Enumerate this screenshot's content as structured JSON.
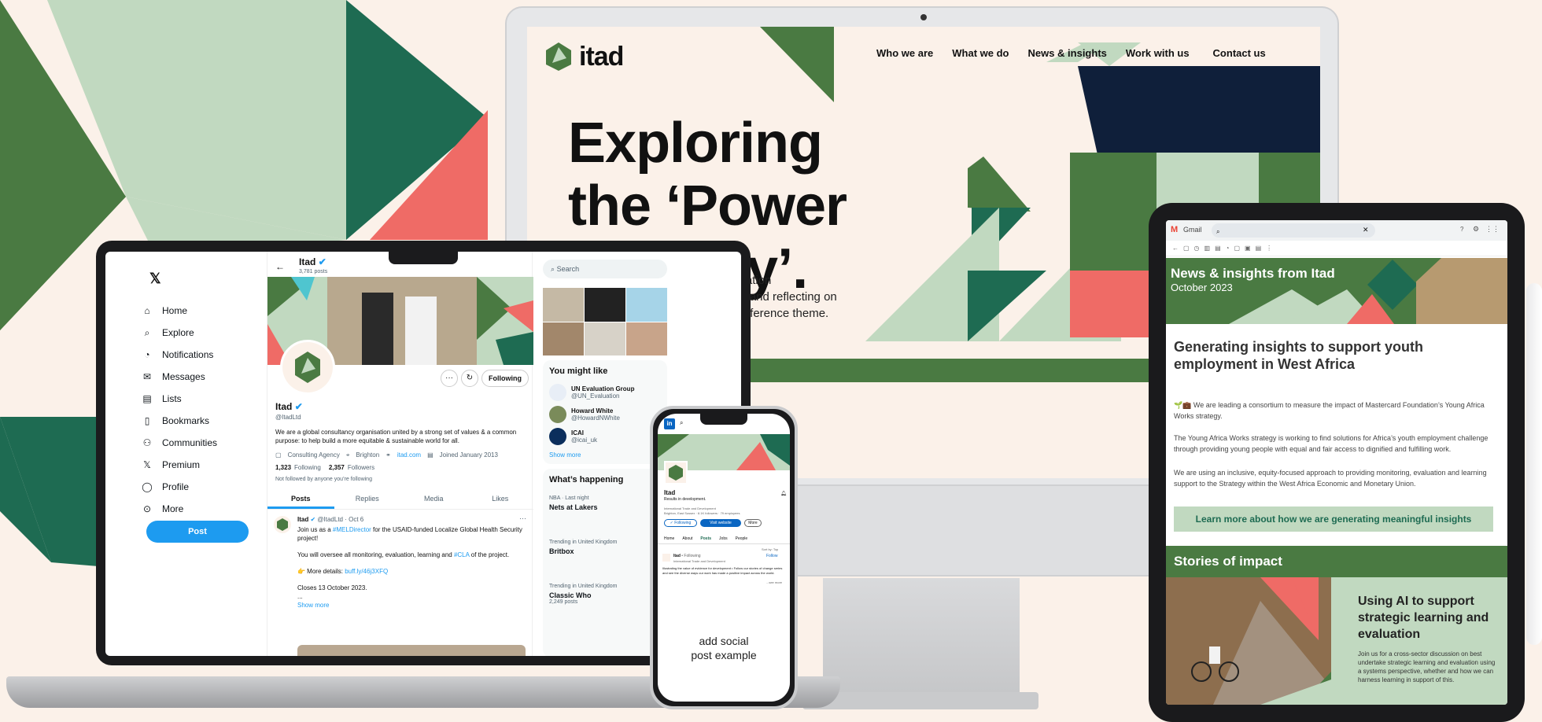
{
  "monitor_site": {
    "logo_text": "itad",
    "nav": [
      "Who we are",
      "What we do",
      "News & insights",
      "Work with us",
      "Contact us"
    ],
    "hero_line1": "Exploring",
    "hero_line2": "the ‘Power",
    "hero_line3": "ry’.",
    "body_line1": "n Association",
    "body_line2": "ns, skills and reflecting on",
    "body_line3": "ear’s conference theme."
  },
  "twitter": {
    "nav": [
      {
        "label": "Home",
        "icon": "home-icon"
      },
      {
        "label": "Explore",
        "icon": "search-icon"
      },
      {
        "label": "Notifications",
        "icon": "bell-icon"
      },
      {
        "label": "Messages",
        "icon": "mail-icon"
      },
      {
        "label": "Lists",
        "icon": "list-icon"
      },
      {
        "label": "Bookmarks",
        "icon": "bookmark-icon"
      },
      {
        "label": "Communities",
        "icon": "communities-icon"
      },
      {
        "label": "Premium",
        "icon": "x-icon"
      },
      {
        "label": "Profile",
        "icon": "person-icon"
      },
      {
        "label": "More",
        "icon": "more-icon"
      }
    ],
    "post_button": "Post",
    "header_name": "Itad",
    "header_posts": "3,781 posts",
    "following_btn": "Following",
    "profile_name": "Itad",
    "handle": "@ItadLtd",
    "bio": "We are a global consultancy organisation united by a strong set of values & a common purpose: to help build a more equitable & sustainable world for all.",
    "category": "Consulting Agency",
    "location": "Brighton",
    "website": "itad.com",
    "joined": "Joined January 2013",
    "following_count": "1,323",
    "following_label": "Following",
    "followers_count": "2,357",
    "followers_label": "Followers",
    "not_followed": "Not followed by anyone you’re following",
    "tabs": [
      "Posts",
      "Replies",
      "Media",
      "Likes"
    ],
    "tweet_author": "Itad",
    "tweet_meta": "@ItadLtd · Oct 6",
    "tweet_p1a": "Join us as a ",
    "tweet_p1link": "#MELDirector",
    "tweet_p1b": " for the USAID-funded Localize Global Health Security project!",
    "tweet_p2a": "You will oversee all monitoring, evaluation, learning and ",
    "tweet_p2link": "#CLA",
    "tweet_p2b": " of the project.",
    "tweet_p3a": "👉 More details: ",
    "tweet_p3link": "buff.ly/46j3XFQ",
    "tweet_p4": "Closes 13 October 2023.",
    "tweet_p5": "...",
    "show_more": "Show more",
    "search_placeholder": "Search",
    "you_might_like": "You might like",
    "suggestions": [
      {
        "name": "UN Evaluation Group",
        "handle": "@UN_Evaluation"
      },
      {
        "name": "Howard White",
        "handle": "@HowardNWhite"
      },
      {
        "name": "ICAI",
        "handle": "@icai_uk"
      }
    ],
    "show_more_right": "Show more",
    "whats_happening": "What’s happening",
    "trends": [
      {
        "meta": "NBA · Last night",
        "title": "Nets at Lakers",
        "posts": ""
      },
      {
        "meta": "Trending in United Kingdom",
        "title": "Britbox",
        "posts": ""
      },
      {
        "meta": "Trending in United Kingdom",
        "title": "Classic Who",
        "posts": "2,249 posts"
      }
    ]
  },
  "phone": {
    "linkedin_name": "Itad",
    "linkedin_tagline": "Results in development.",
    "linkedin_meta1": "International Trade and Development",
    "linkedin_meta2": "Brighton, East Sussex · 8.1K followers · 79 employees",
    "following_btn": "✓ Following",
    "visit_btn": "Visit website",
    "more_btn": "More",
    "tabs": [
      "Home",
      "About",
      "Posts",
      "Jobs",
      "People"
    ],
    "sort_by": "Sort by: Top",
    "post_author": "Itad",
    "post_author_meta": "• Following",
    "post_sub": "International Trade and Development",
    "follow_btn": "Follow",
    "post_text": "Illustrating the value of evidence for development • Follow our stories of change series and see the diverse ways our work has made a positive impact across the world.",
    "see_more": "...see more",
    "note_line1": "add social",
    "note_line2": "post example"
  },
  "gmail": {
    "app_name": "Gmail",
    "banner_title": "News & insights from Itad",
    "banner_date": "October 2023",
    "article_title": "Generating insights to support youth employment in West Africa",
    "p1": "🌱💼 We are leading a consortium to measure the impact of Mastercard Foundation’s Young Africa Works strategy.",
    "p2": "The Young Africa Works strategy is working to find solutions for Africa’s youth employment challenge through providing young people with equal and fair access to dignified and fulfilling work.",
    "p3": "We are using an inclusive, equity-focused approach to providing monitoring, evaluation and learning support to the Strategy within the West Africa Economic and Monetary Union.",
    "cta": "Learn more about how we are generating meaningful insights",
    "stories_heading": "Stories of impact",
    "story_title": "Using AI to support strategic learning and evaluation",
    "story_text": "Join us for a cross-sector discussion on best undertake strategic learning and evaluation using a systems perspective, whether and how we can harness learning in support of this."
  },
  "colors": {
    "dark_green": "#4a7a42",
    "teal_green": "#1e6b52",
    "light_green": "#c1d9c0",
    "coral": "#ef6b66",
    "cream": "#fbf1e9",
    "twitter_blue": "#1d9bf0"
  }
}
